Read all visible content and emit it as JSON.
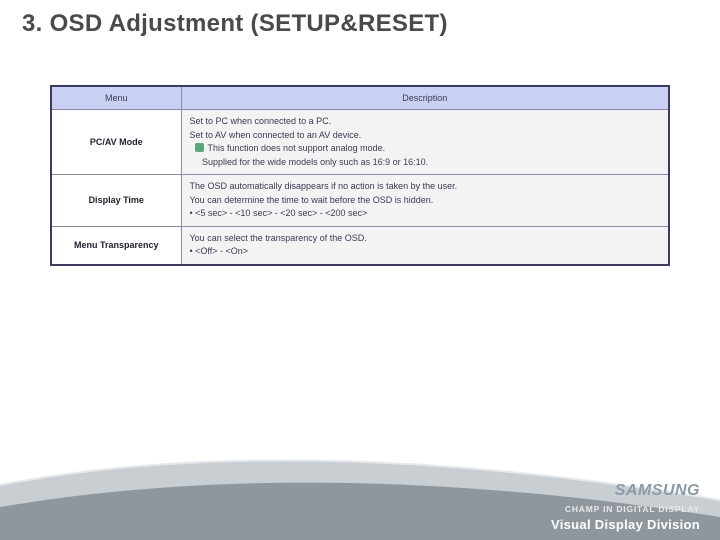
{
  "title": "3. OSD Adjustment (SETUP&RESET)",
  "header": {
    "menu": "Menu",
    "desc": "Description"
  },
  "rows": [
    {
      "menu": "PC/AV Mode",
      "l1": "Set to PC when connected to a PC.",
      "l2": "Set to AV when connected to an AV device.",
      "l3": "This function does not support analog mode.",
      "l4": "Supplied for the wide models only such as 16:9 or 16:10."
    },
    {
      "menu": "Display Time",
      "l1": "The OSD automatically disappears if no action is taken by the user.",
      "l2": "You can determine the time to wait before the OSD is hidden.",
      "l3": "• <5 sec> - <10 sec> - <20 sec> - <200 sec>"
    },
    {
      "menu": "Menu Transparency",
      "l1": "You can select the transparency of the OSD.",
      "l2": "• <Off> - <On>"
    }
  ],
  "footer": {
    "brand": "SAMSUNG",
    "tagline": "CHAMP IN DIGITAL DISPLAY",
    "division": "Visual Display Division"
  }
}
